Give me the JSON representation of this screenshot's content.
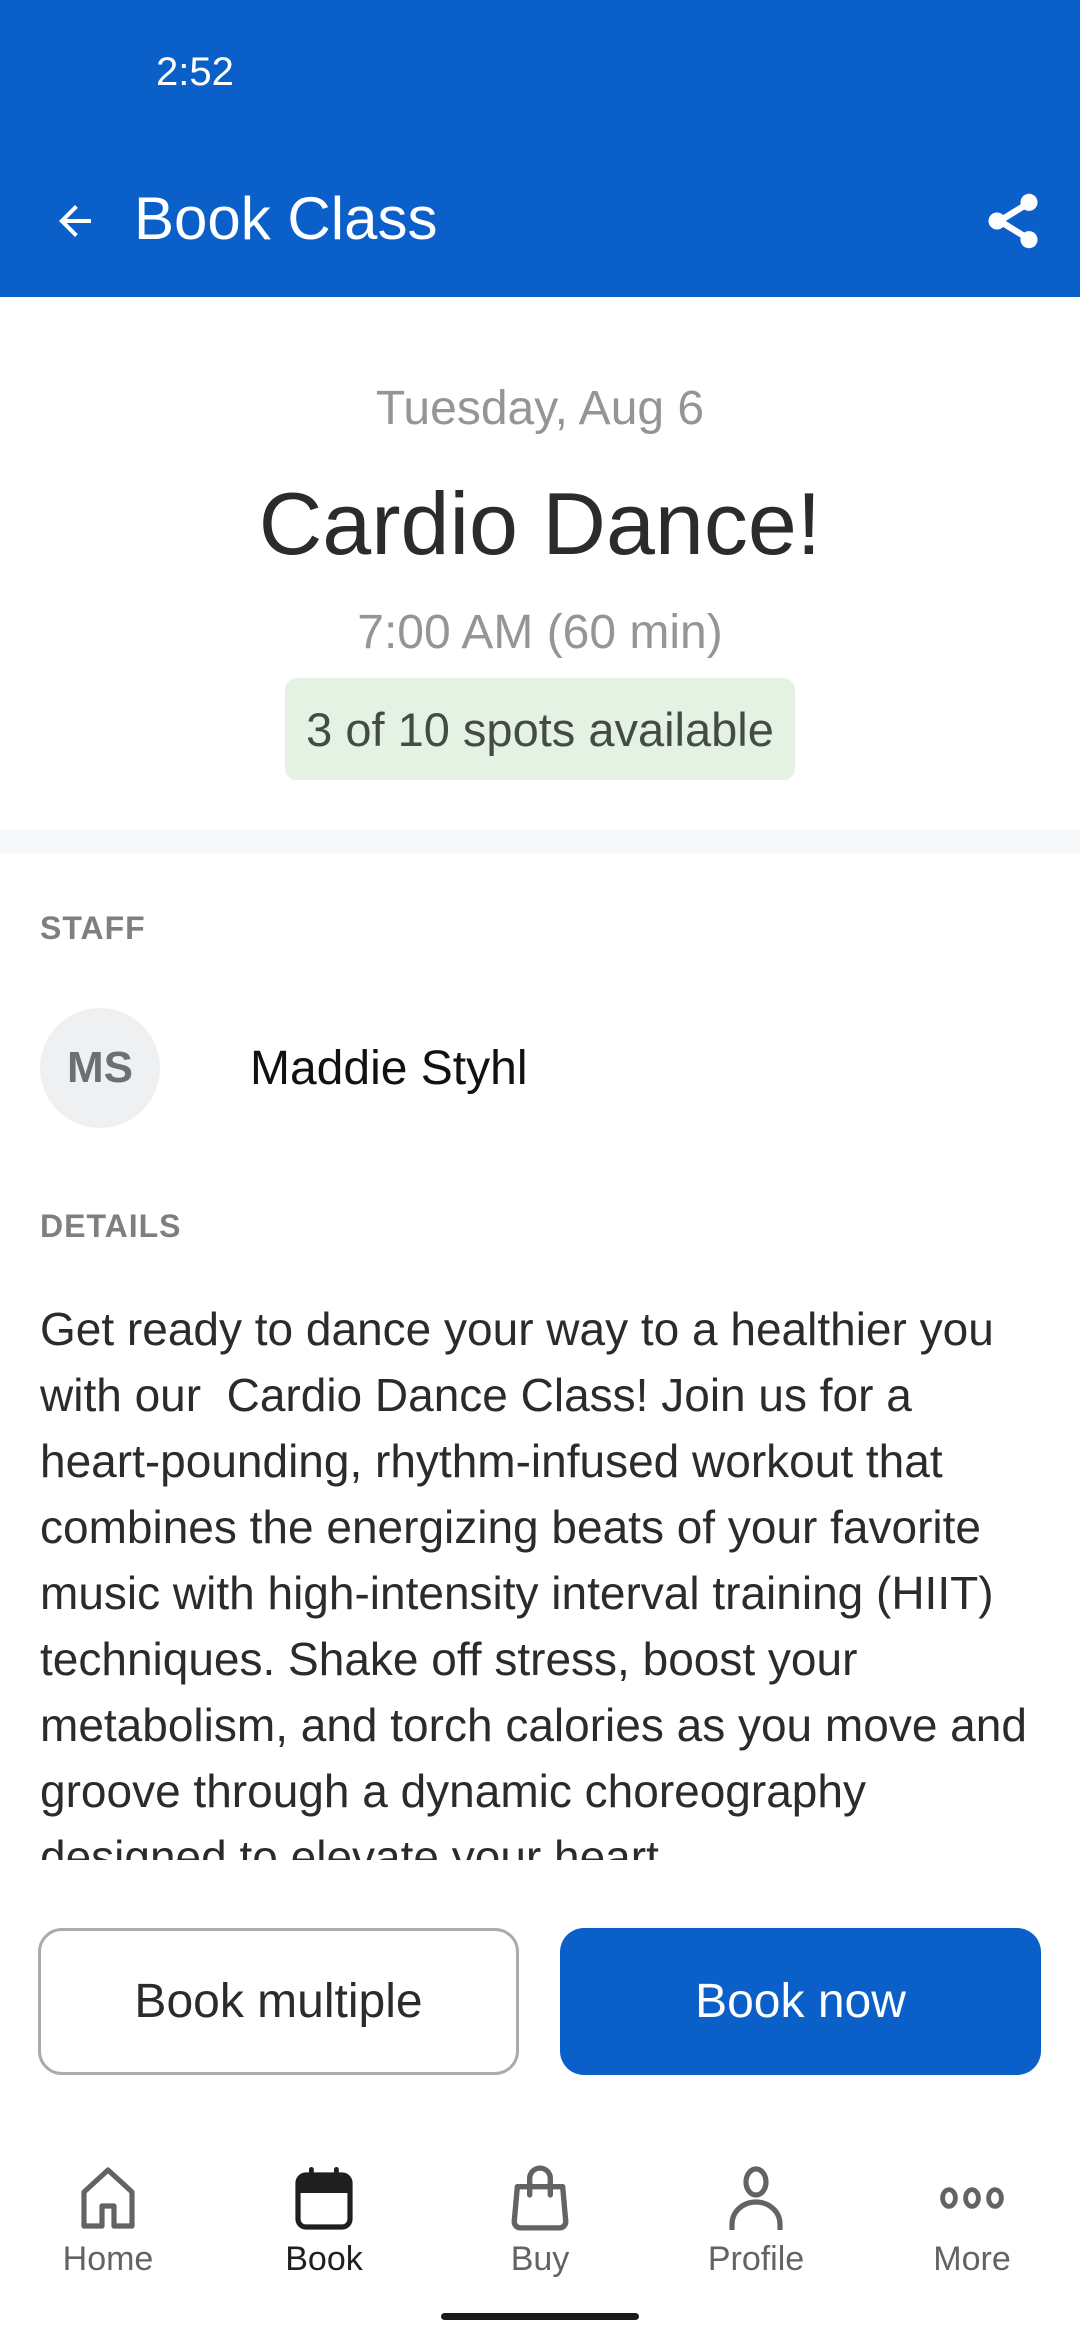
{
  "status_bar": {
    "time": "2:52"
  },
  "app_bar": {
    "title": "Book Class",
    "back_icon": "arrow-back-icon",
    "share_icon": "share-icon",
    "background_color": "#0a60c8"
  },
  "class_info": {
    "date": "Tuesday, Aug 6",
    "title": "Cardio Dance!",
    "time": "7:00 AM (60 min)",
    "spots": {
      "label": "3 of 10 spots available",
      "available": 3,
      "total": 10,
      "badge_color": "#e4f2e4"
    }
  },
  "staff": {
    "section_label": "STAFF",
    "initials": "MS",
    "name": "Maddie Styhl"
  },
  "details": {
    "section_label": "DETAILS",
    "text": "Get ready to dance your way to a healthier you with our  Cardio Dance Class! Join us for a heart-pounding, rhythm-infused workout that combines the energizing beats of your favorite music with high-intensity interval training (HIIT) techniques. Shake off stress, boost your metabolism, and torch calories as you move and groove through a dynamic choreography designed to elevate your heart"
  },
  "actions": {
    "book_multiple": "Book multiple",
    "book_now": "Book now",
    "primary_color": "#0a60c8"
  },
  "bottom_nav": {
    "items": [
      {
        "label": "Home",
        "icon": "home-icon",
        "active": false
      },
      {
        "label": "Book",
        "icon": "calendar-icon",
        "active": true
      },
      {
        "label": "Buy",
        "icon": "shopping-bag-icon",
        "active": false
      },
      {
        "label": "Profile",
        "icon": "person-icon",
        "active": false
      },
      {
        "label": "More",
        "icon": "more-dots-icon",
        "active": false
      }
    ]
  }
}
